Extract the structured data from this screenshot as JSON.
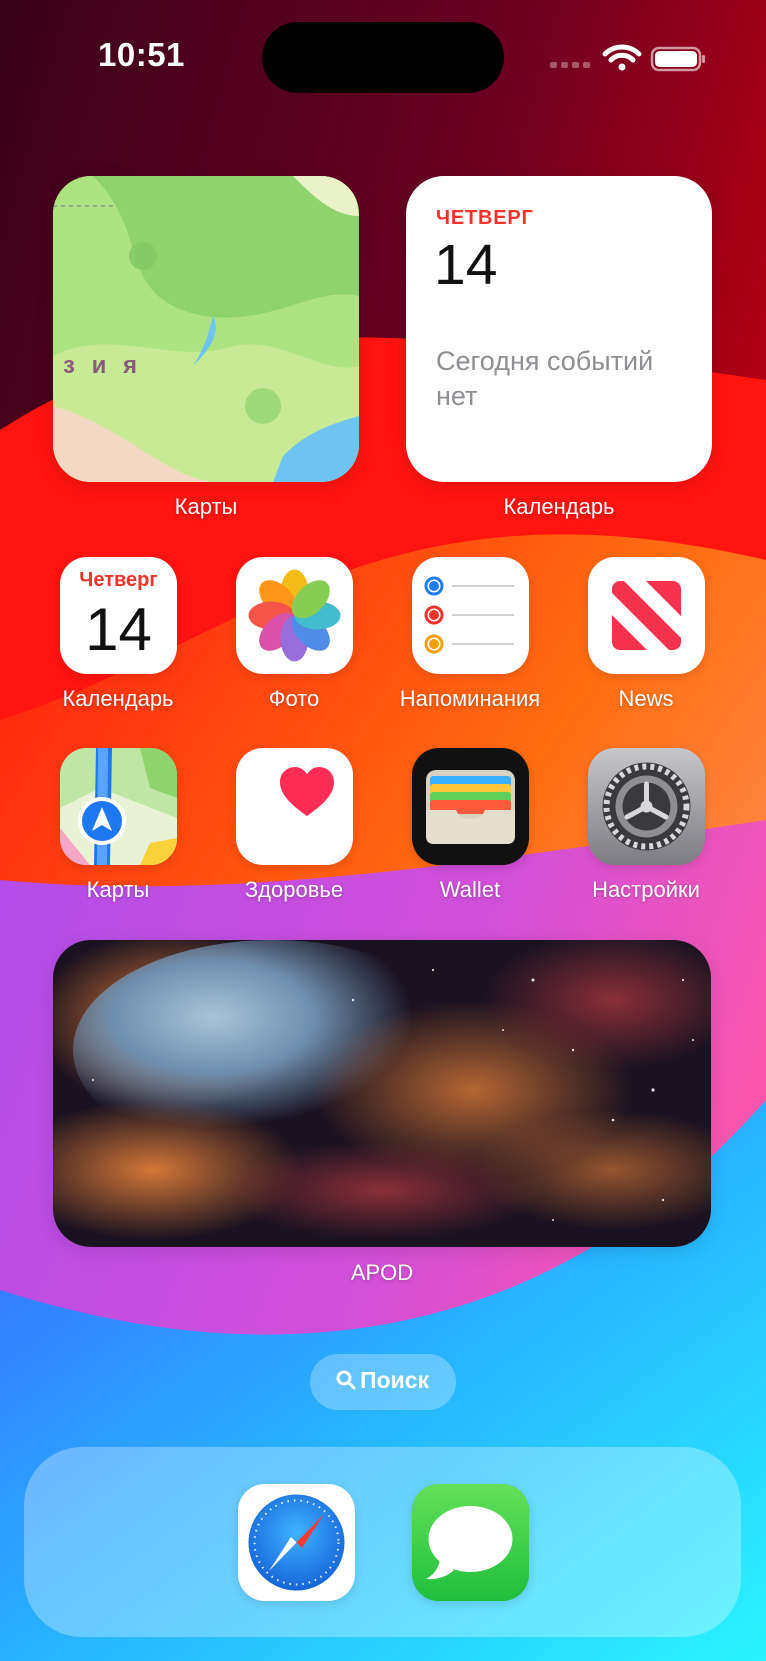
{
  "status_bar": {
    "time": "10:51"
  },
  "widgets": {
    "maps": {
      "map_text": "з и я",
      "label": "Карты"
    },
    "calendar": {
      "day": "ЧЕТВЕРГ",
      "date": "14",
      "message": "Сегодня событий нет",
      "label": "Календарь"
    },
    "apod": {
      "label": "APOD"
    }
  },
  "apps": [
    {
      "label": "Календарь",
      "icon": "calendar-icon",
      "day": "Четверг",
      "date": "14"
    },
    {
      "label": "Фото",
      "icon": "photos-icon"
    },
    {
      "label": "Напоминания",
      "icon": "reminders-icon"
    },
    {
      "label": "News",
      "icon": "news-icon"
    },
    {
      "label": "Карты",
      "icon": "maps-icon"
    },
    {
      "label": "Здоровье",
      "icon": "health-icon"
    },
    {
      "label": "Wallet",
      "icon": "wallet-icon"
    },
    {
      "label": "Настройки",
      "icon": "settings-icon"
    }
  ],
  "search": {
    "label": "Поиск",
    "icon": "magnifier-icon"
  },
  "dock": [
    {
      "app": "Safari",
      "icon": "safari-icon"
    },
    {
      "app": "Messages",
      "icon": "messages-icon"
    }
  ],
  "colors": {
    "calendar_red": "#f0342c",
    "messages_green": "#34c759",
    "safari_blue": "#1e8cf0"
  }
}
